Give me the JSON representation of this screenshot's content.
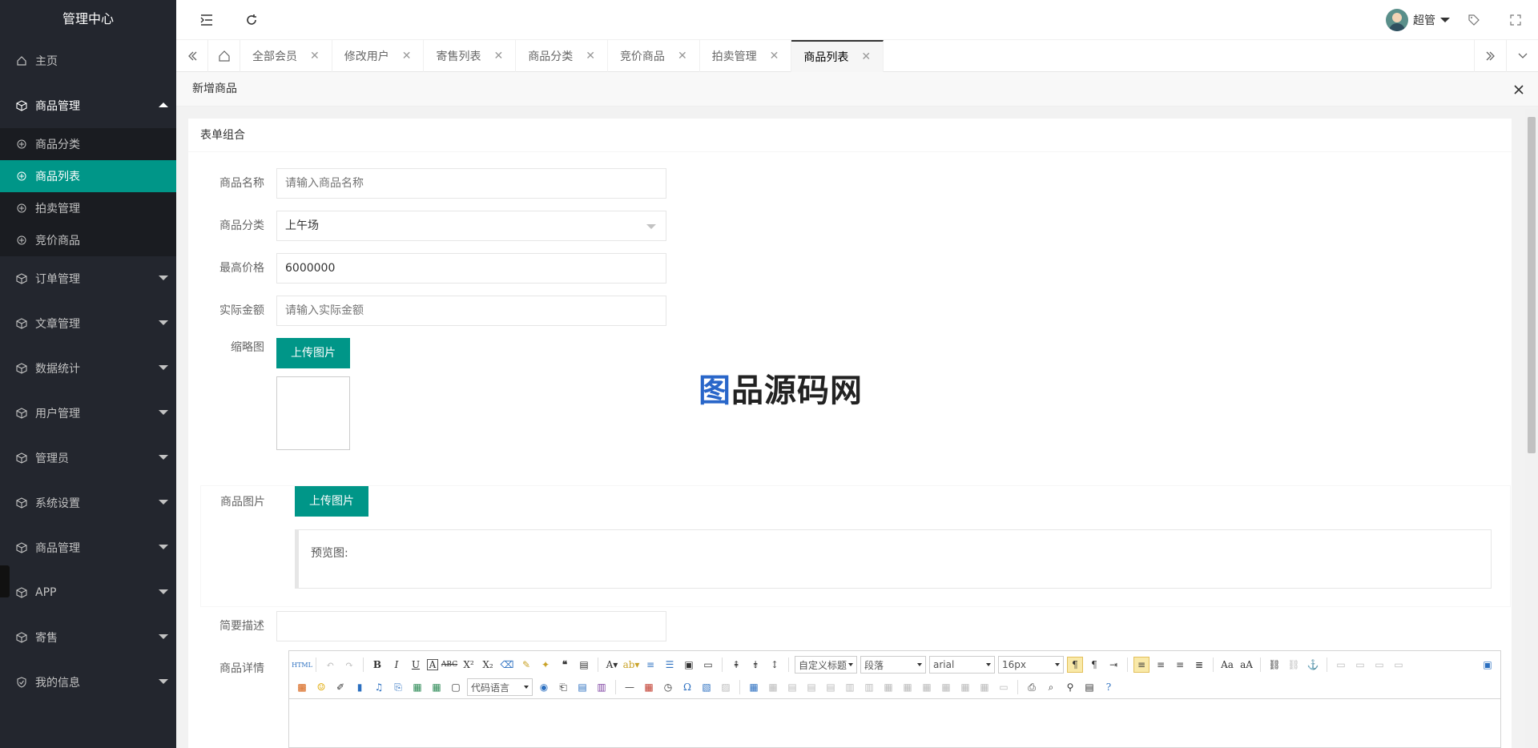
{
  "sidebar": {
    "title": "管理中心",
    "home": "主页",
    "product_mgmt": "商品管理",
    "sub_items": [
      "商品分类",
      "商品列表",
      "拍卖管理",
      "竞价商品"
    ],
    "menu": [
      "订单管理",
      "文章管理",
      "数据统计",
      "用户管理",
      "管理员",
      "系统设置",
      "商品管理",
      "APP",
      "寄售",
      "我的信息"
    ]
  },
  "header": {
    "user_name": "超管",
    "icons": [
      "menu-fold-icon",
      "refresh-icon",
      "tag-icon",
      "fullscreen-icon"
    ]
  },
  "tabs": {
    "home_icon": "home-icon",
    "items": [
      "全部会员",
      "修改用户",
      "寄售列表",
      "商品分类",
      "竞价商品",
      "拍卖管理",
      "商品列表"
    ],
    "active_index": 6
  },
  "modal": {
    "title": "新增商品"
  },
  "form": {
    "section_title": "表单组合",
    "name_label": "商品名称",
    "name_placeholder": "请输入商品名称",
    "category_label": "商品分类",
    "category_value": "上午场",
    "max_price_label": "最高价格",
    "max_price_value": "6000000",
    "actual_amount_label": "实际金额",
    "actual_amount_placeholder": "请输入实际金额",
    "thumb_label": "缩略图",
    "upload_btn": "上传图片",
    "images_label": "商品图片",
    "preview_label": "预览图:",
    "brief_label": "简要描述",
    "detail_label": "商品详情"
  },
  "editor": {
    "combo_heading": "自定义标题",
    "combo_para": "段落",
    "combo_font": "arial",
    "combo_size": "16px",
    "combo_code": "代码语言"
  },
  "watermark": {
    "text_a": "图",
    "text_b": "品源码网"
  },
  "colors": {
    "sidebar_bg": "#23262e",
    "accent": "#009688"
  }
}
